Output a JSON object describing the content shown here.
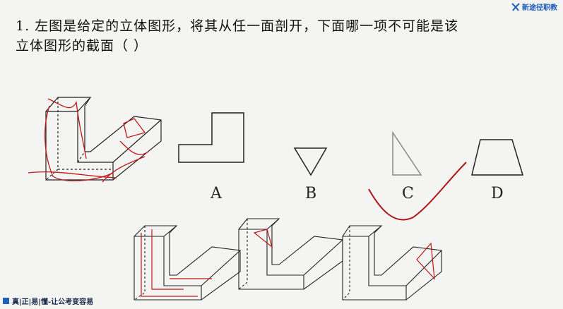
{
  "question": {
    "line1": "1. 左图是给定的立体图形，将其从任一面剖开，下面哪一项不可能是该",
    "line2": "立体图形的截面（   ）"
  },
  "brand": {
    "text": "新途径职教",
    "color": "#1e5fb8"
  },
  "options": [
    {
      "letter": "A"
    },
    {
      "letter": "B"
    },
    {
      "letter": "C"
    },
    {
      "letter": "D"
    }
  ],
  "footer": {
    "text": "真|正|易|懂-让公考变容易"
  },
  "colors": {
    "annotation": "#c01818",
    "line": "#222222"
  },
  "icons": [
    "brand-logo-icon",
    "footer-square-icon"
  ]
}
